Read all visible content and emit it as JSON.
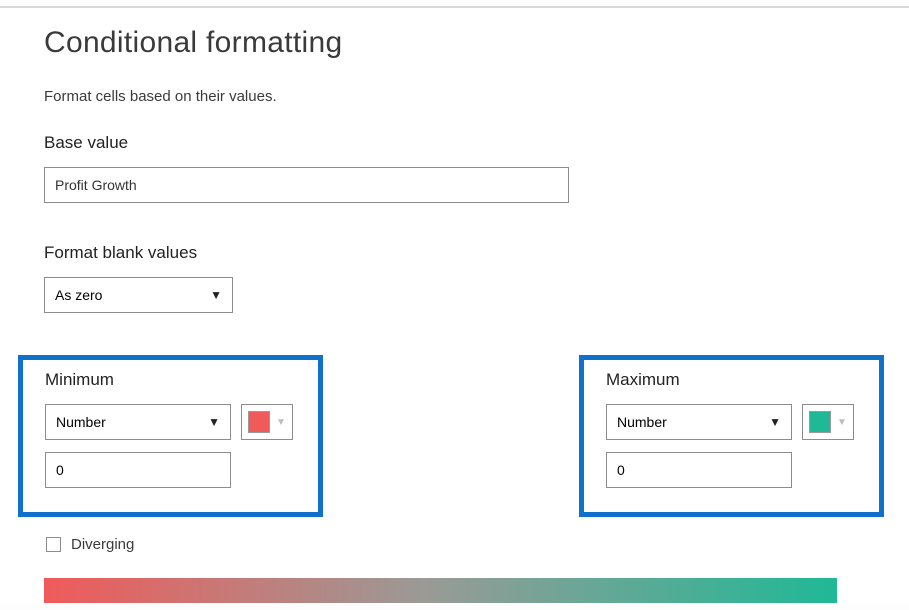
{
  "dialog": {
    "title": "Conditional formatting",
    "description": "Format cells based on their values.",
    "base_value": {
      "label": "Base value",
      "value": "Profit Growth"
    },
    "format_blank": {
      "label": "Format blank values",
      "selected": "As zero"
    },
    "minimum": {
      "label": "Minimum",
      "type_selected": "Number",
      "value": "0",
      "color": "#f05a5a"
    },
    "maximum": {
      "label": "Maximum",
      "type_selected": "Number",
      "value": "0",
      "color": "#1fb996"
    },
    "diverging": {
      "label": "Diverging",
      "checked": false
    },
    "gradient": {
      "start_color": "#f05a5a",
      "mid_color": "#9a9a96",
      "end_color": "#1fb996"
    }
  }
}
